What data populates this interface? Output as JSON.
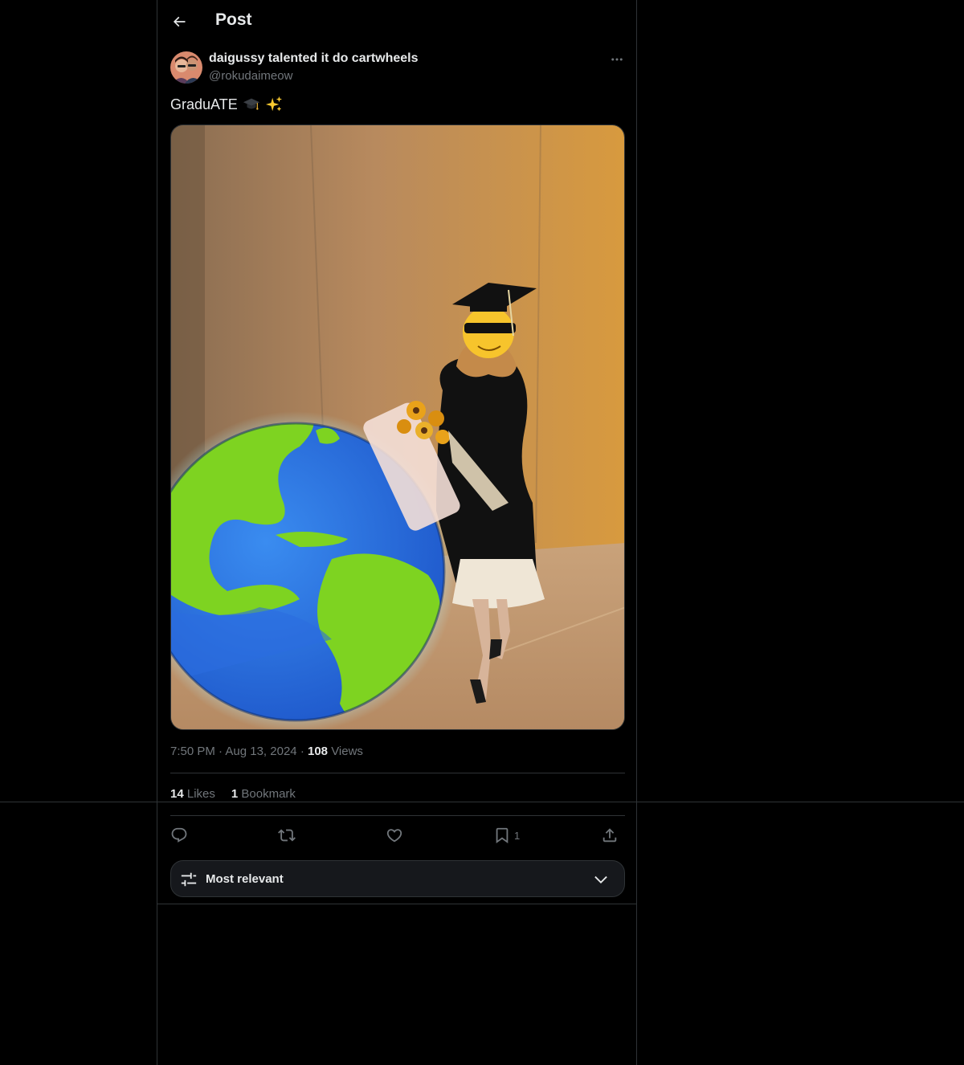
{
  "header": {
    "title": "Post"
  },
  "post": {
    "author_name": "daigussy talented it do cartwheels",
    "author_handle": "@rokudaimeow",
    "text": "GraduATE",
    "text_emojis": [
      "graduation-cap-icon",
      "sparkles-icon"
    ],
    "time": "7:50 PM",
    "date": "Aug 13, 2024",
    "views_count": "108",
    "views_label": "Views",
    "separator": "·"
  },
  "stats": {
    "likes_count": "14",
    "likes_label": "Likes",
    "bookmarks_count": "1",
    "bookmarks_label": "Bookmark"
  },
  "actions": {
    "reply_icon": "reply-icon",
    "repost_icon": "repost-icon",
    "like_icon": "heart-icon",
    "bookmark_icon": "bookmark-icon",
    "bookmark_count": "1",
    "share_icon": "share-icon"
  },
  "replies_sort": {
    "label": "Most relevant"
  },
  "colors": {
    "background": "#000000",
    "text_primary": "#e7e9ea",
    "text_secondary": "#71767b",
    "border": "#2f3336"
  }
}
